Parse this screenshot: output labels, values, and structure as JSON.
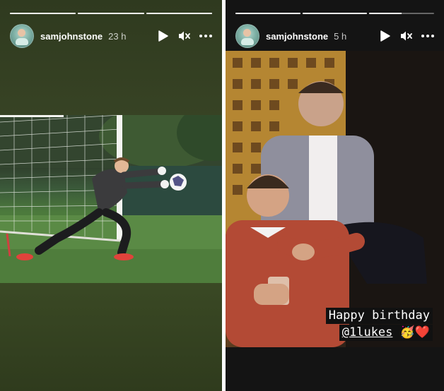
{
  "stories": [
    {
      "username": "samjohnstone",
      "time": "23 h",
      "progress": [
        1,
        1,
        1
      ],
      "media": {}
    },
    {
      "username": "samjohnstone",
      "time": "5 h",
      "progress": [
        1,
        1,
        0.5
      ],
      "caption": {
        "line1": "Happy birthday",
        "mention": "@1lukes",
        "emoji": "🥳❤️"
      }
    }
  ],
  "icons": {
    "play": "play-icon",
    "mute": "muted-speaker-icon",
    "more": "more-options-icon"
  },
  "colors": {
    "progress_active": "#ffffff",
    "progress_inactive": "rgba(255,255,255,0.35)"
  }
}
